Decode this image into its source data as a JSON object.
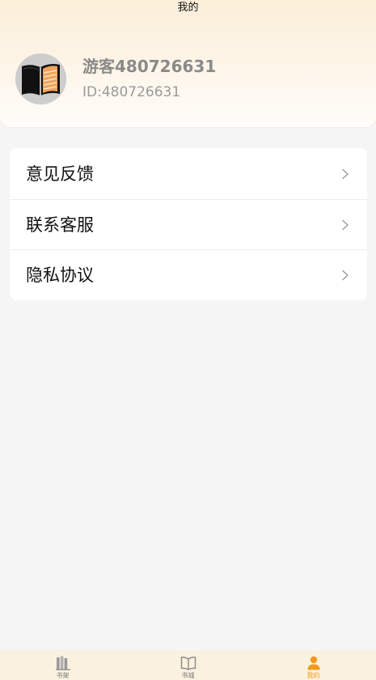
{
  "header": {
    "title": "我的"
  },
  "profile": {
    "username": "游客480726631",
    "user_id": "ID:480726631",
    "avatar_icon": "book-avatar-icon"
  },
  "menu": {
    "items": [
      {
        "label": "意见反馈",
        "icon": "chevron-right-icon"
      },
      {
        "label": "联系客服",
        "icon": "chevron-right-icon"
      },
      {
        "label": "隐私协议",
        "icon": "chevron-right-icon"
      }
    ]
  },
  "tabbar": {
    "tabs": [
      {
        "label": "书架",
        "icon": "bookshelf-icon",
        "active": false
      },
      {
        "label": "书城",
        "icon": "open-book-icon",
        "active": false
      },
      {
        "label": "我的",
        "icon": "person-icon",
        "active": true
      }
    ]
  },
  "colors": {
    "accent": "#f09a1b",
    "header_gradient_top": "#fbefd9",
    "tabbar_bg": "#fbf1df",
    "page_bg": "#f5f5f5"
  }
}
